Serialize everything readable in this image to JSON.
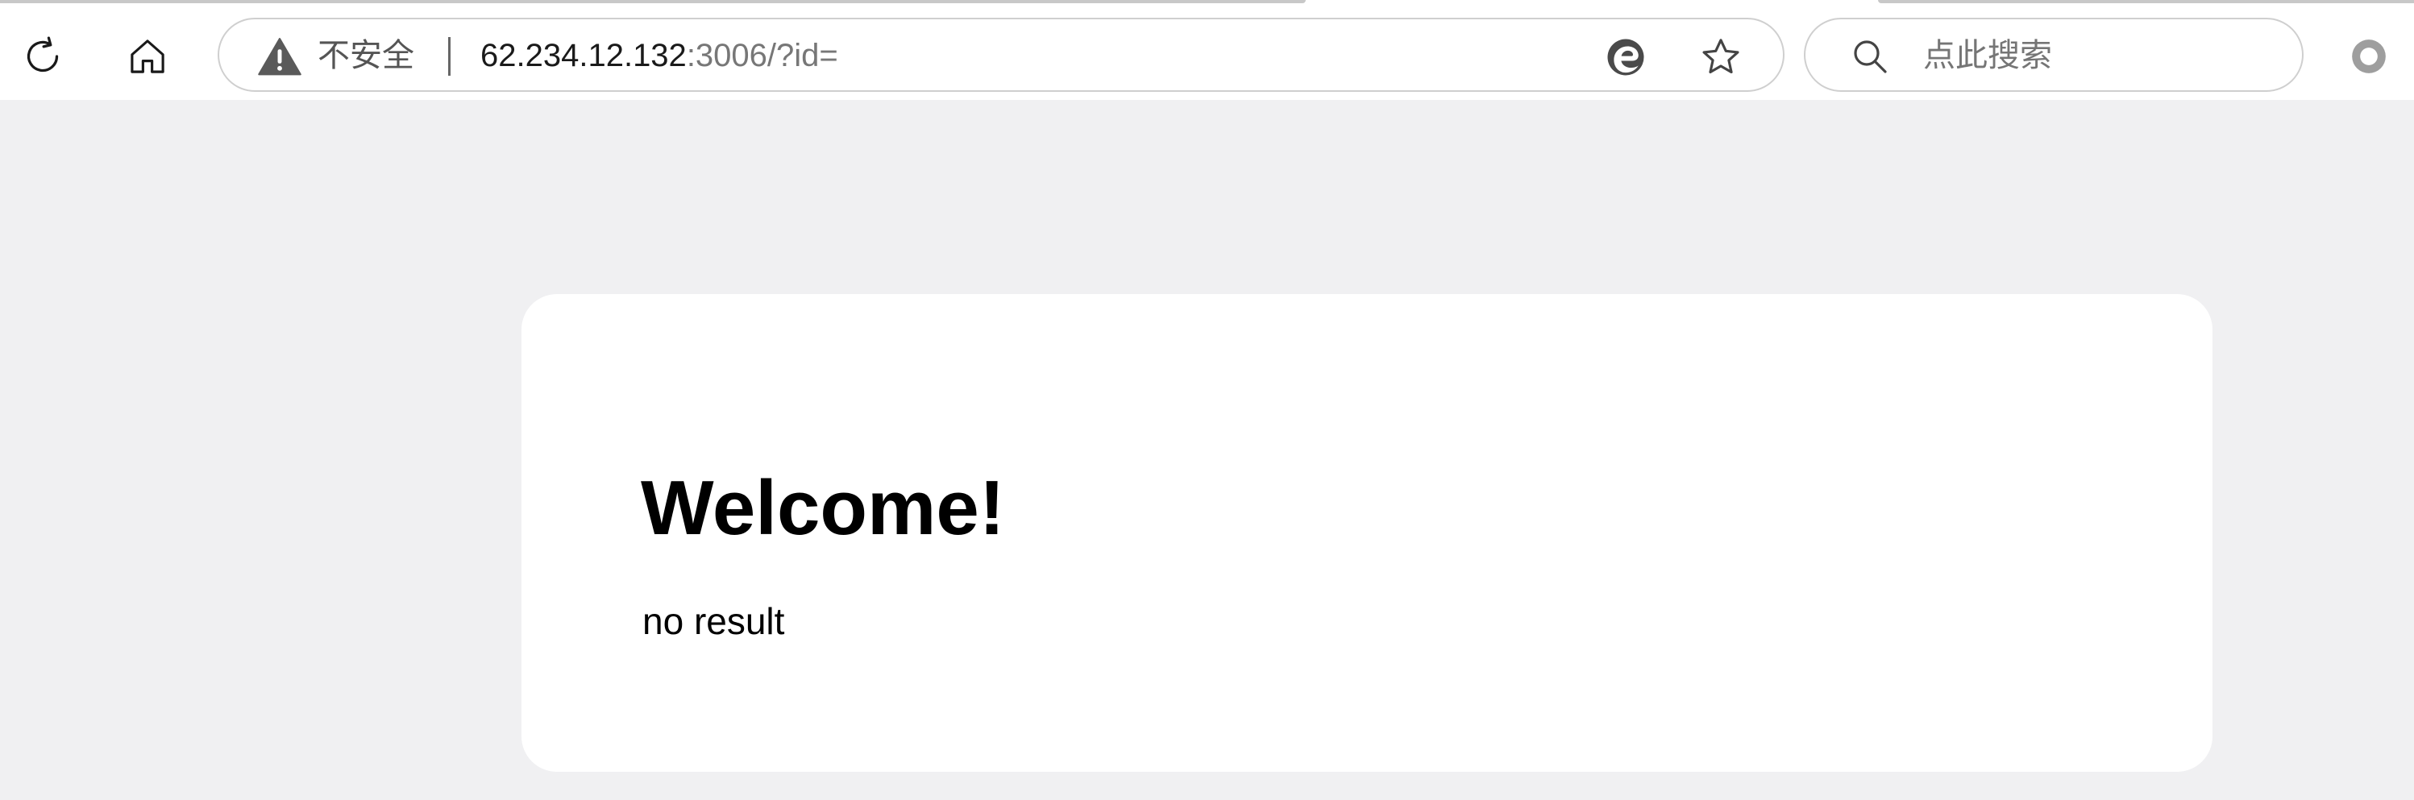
{
  "browser": {
    "address_bar": {
      "security_label": "不安全",
      "url_host": "62.234.12.132",
      "url_rest": ":3006/?id="
    },
    "search": {
      "placeholder": "点此搜索"
    },
    "icons": {
      "reload": "reload-icon",
      "home": "home-icon",
      "warning": "warning-triangle-icon",
      "edge": "edge-logo-icon",
      "favorite": "star-icon",
      "search": "search-icon",
      "profile": "profile-icon"
    }
  },
  "page": {
    "heading": "Welcome!",
    "result": "no result"
  },
  "colors": {
    "page_background": "#f0f0f2",
    "card_background": "#ffffff",
    "toolbar_background": "#ffffff",
    "warning_icon": "#5a5a5a"
  }
}
